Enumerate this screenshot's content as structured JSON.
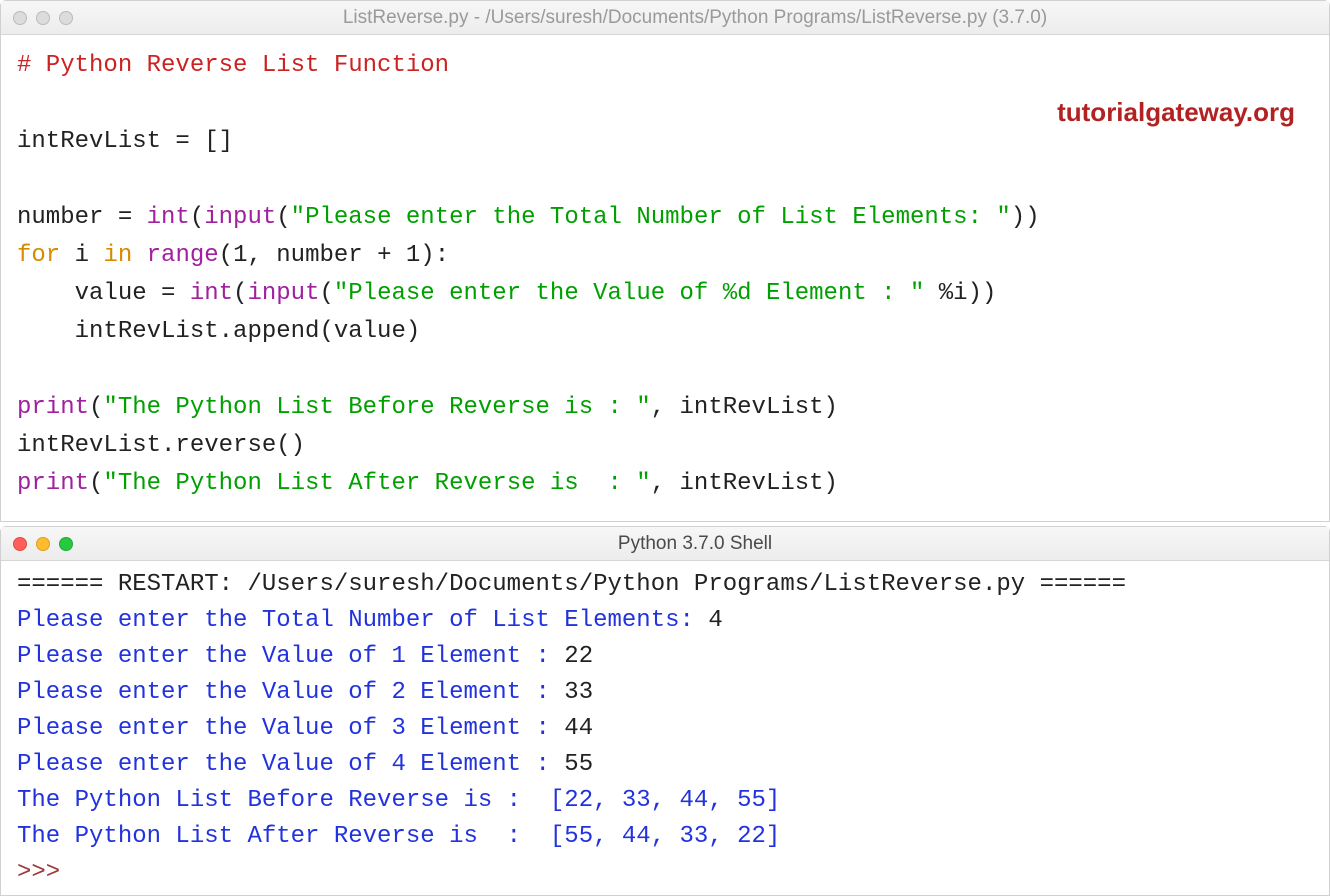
{
  "editor": {
    "title": "ListReverse.py - /Users/suresh/Documents/Python Programs/ListReverse.py (3.7.0)",
    "watermark": "tutorialgateway.org",
    "code": {
      "l1_comment": "# Python Reverse List Function",
      "l3_a": "intRevList = []",
      "l5_a": "number = ",
      "l5_b": "int",
      "l5_c": "(",
      "l5_d": "input",
      "l5_e": "(",
      "l5_f": "\"Please enter the Total Number of List Elements: \"",
      "l5_g": "))",
      "l6_a": "for",
      "l6_b": " i ",
      "l6_c": "in",
      "l6_d": " ",
      "l6_e": "range",
      "l6_f": "(1, number + 1):",
      "l7_a": "    value = ",
      "l7_b": "int",
      "l7_c": "(",
      "l7_d": "input",
      "l7_e": "(",
      "l7_f": "\"Please enter the Value of %d Element : \"",
      "l7_g": " %i))",
      "l8_a": "    intRevList.append(value)",
      "l10_a": "print",
      "l10_b": "(",
      "l10_c": "\"The Python List Before Reverse is : \"",
      "l10_d": ", intRevList)",
      "l11_a": "intRevList.reverse()",
      "l12_a": "print",
      "l12_b": "(",
      "l12_c": "\"The Python List After Reverse is  : \"",
      "l12_d": ", intRevList)"
    }
  },
  "shell": {
    "title": "Python 3.7.0 Shell",
    "restart_line": "====== RESTART: /Users/suresh/Documents/Python Programs/ListReverse.py ======",
    "io": [
      {
        "prompt": "Please enter the Total Number of List Elements: ",
        "value": "4"
      },
      {
        "prompt": "Please enter the Value of 1 Element : ",
        "value": "22"
      },
      {
        "prompt": "Please enter the Value of 2 Element : ",
        "value": "33"
      },
      {
        "prompt": "Please enter the Value of 3 Element : ",
        "value": "44"
      },
      {
        "prompt": "Please enter the Value of 4 Element : ",
        "value": "55"
      },
      {
        "prompt": "The Python List Before Reverse is :  [22, 33, 44, 55]",
        "value": ""
      },
      {
        "prompt": "The Python List After Reverse is  :  [55, 44, 33, 22]",
        "value": ""
      }
    ],
    "prompt": ">>> "
  }
}
